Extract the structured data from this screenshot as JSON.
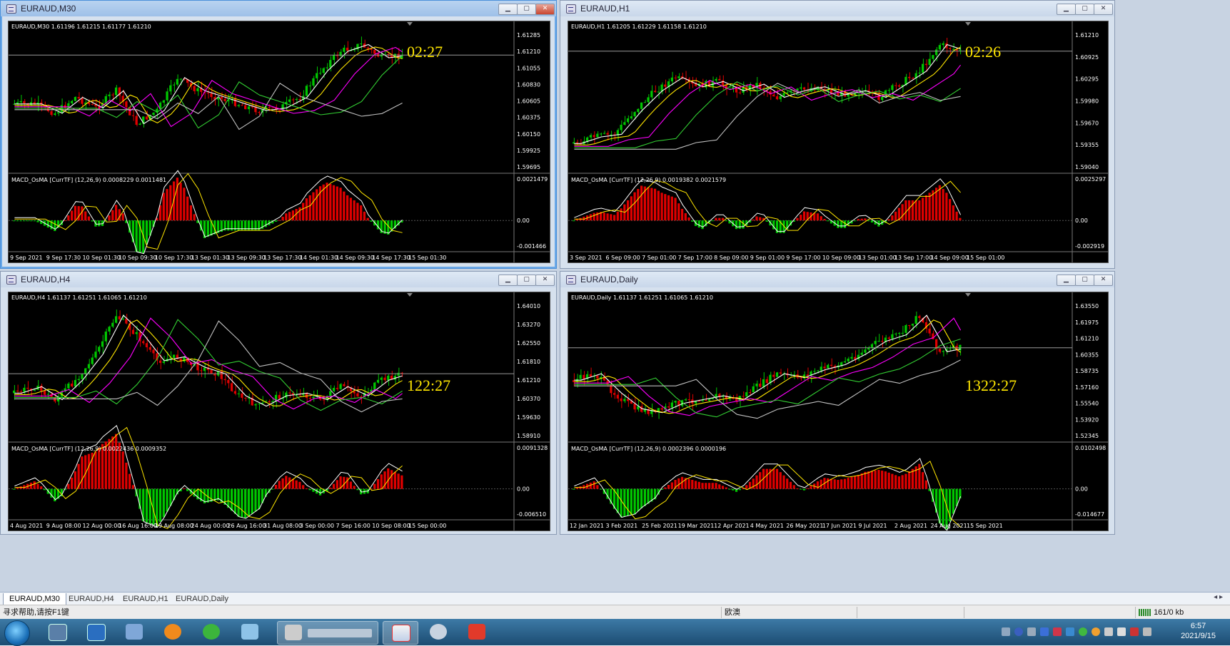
{
  "windows": [
    {
      "title": "EURAUD,M30",
      "active": true,
      "controls": [
        "min",
        "max",
        "close"
      ],
      "info": "EURAUD,M30  1.61196 1.61215 1.61177 1.61210",
      "macd": "MACD_OsMA [CurrTF] (12,26,9) 0.0008229 0.0011481",
      "countdown": "02:27",
      "price_axis": [
        "1.61285",
        "1.61210",
        "1.61055",
        "1.60830",
        "1.60605",
        "1.60375",
        "1.60150",
        "1.59925",
        "1.59695"
      ],
      "macd_axis": [
        "0.0021479",
        "0.00",
        "-0.001466"
      ],
      "time_axis": [
        "9 Sep 2021",
        "9 Sep 17:30",
        "10 Sep 01:30",
        "10 Sep 09:30",
        "10 Sep 17:30",
        "13 Sep 01:30",
        "13 Sep 09:30",
        "13 Sep 17:30",
        "14 Sep 01:30",
        "14 Sep 09:30",
        "14 Sep 17:30",
        "15 Sep 01:30"
      ]
    },
    {
      "title": "EURAUD,H1",
      "active": false,
      "controls": [
        "min",
        "max",
        "close"
      ],
      "info": "EURAUD,H1  1.61205 1.61229 1.61158 1.61210",
      "macd": "MACD_OsMA [CurrTF] (12,26,9) 0.0019382 0.0021579",
      "countdown": "02:26",
      "price_axis": [
        "1.61210",
        "1.60925",
        "1.60295",
        "1.59980",
        "1.59670",
        "1.59355",
        "1.59040"
      ],
      "macd_axis": [
        "0.0025297",
        "0.00",
        "-0.002919"
      ],
      "time_axis": [
        "3 Sep 2021",
        "6 Sep 09:00",
        "7 Sep 01:00",
        "7 Sep 17:00",
        "8 Sep 09:00",
        "9 Sep 01:00",
        "9 Sep 17:00",
        "10 Sep 09:00",
        "13 Sep 01:00",
        "13 Sep 17:00",
        "14 Sep 09:00",
        "15 Sep 01:00"
      ]
    },
    {
      "title": "EURAUD,H4",
      "active": false,
      "controls": [
        "min",
        "max",
        "close"
      ],
      "info": "EURAUD,H4  1.61137 1.61251 1.61065 1.61210",
      "macd": "MACD_OsMA [CurrTF] (12,26,9) 0.0022436 0.0009352",
      "countdown": "122:27",
      "price_axis": [
        "1.64010",
        "1.63270",
        "1.62550",
        "1.61810",
        "1.61210",
        "1.60370",
        "1.59630",
        "1.58910"
      ],
      "macd_axis": [
        "0.0091328",
        "0.00",
        "-0.006510"
      ],
      "time_axis": [
        "4 Aug 2021",
        "9 Aug 08:00",
        "12 Aug 00:00",
        "16 Aug 16:00",
        "19 Aug 08:00",
        "24 Aug 00:00",
        "26 Aug 16:00",
        "31 Aug 08:00",
        "3 Sep 00:00",
        "7 Sep 16:00",
        "10 Sep 08:00",
        "15 Sep 00:00"
      ]
    },
    {
      "title": "EURAUD,Daily",
      "active": false,
      "controls": [
        "min",
        "max",
        "close"
      ],
      "info": "EURAUD,Daily  1.61137 1.61251 1.61065 1.61210",
      "macd": "MACD_OsMA [CurrTF] (12,26,9) 0.0002396 0.0000196",
      "countdown": "1322:27",
      "price_axis": [
        "1.63550",
        "1.61975",
        "1.61210",
        "1.60355",
        "1.58735",
        "1.57160",
        "1.55540",
        "1.53920",
        "1.52345"
      ],
      "macd_axis": [
        "0.0102498",
        "0.00",
        "-0.014677"
      ],
      "time_axis": [
        "12 Jan 2021",
        "3 Feb 2021",
        "25 Feb 2021",
        "19 Mar 2021",
        "12 Apr 2021",
        "4 May 2021",
        "26 May 2021",
        "17 Jun 2021",
        "9 Jul 2021",
        "2 Aug 2021",
        "24 Aug 2021",
        "15 Sep 2021"
      ]
    }
  ],
  "tabs": [
    "EURAUD,M30",
    "EURAUD,H4",
    "EURAUD,H1",
    "EURAUD,Daily"
  ],
  "status": {
    "help": "寻求帮助,请按F1键",
    "profile": "欧澳",
    "traffic": "161/0 kb"
  },
  "clock": {
    "time": "6:57",
    "date": "2021/9/15"
  },
  "colors": {
    "bull": "#00c800",
    "bear": "#e00000",
    "ma_white": "#ffffff",
    "ma_yellow": "#ffe600",
    "ma_magenta": "#ff00ff",
    "ma_green": "#32cd32",
    "ma_gray": "#c0c0c0",
    "countdown": "#ffe600"
  }
}
